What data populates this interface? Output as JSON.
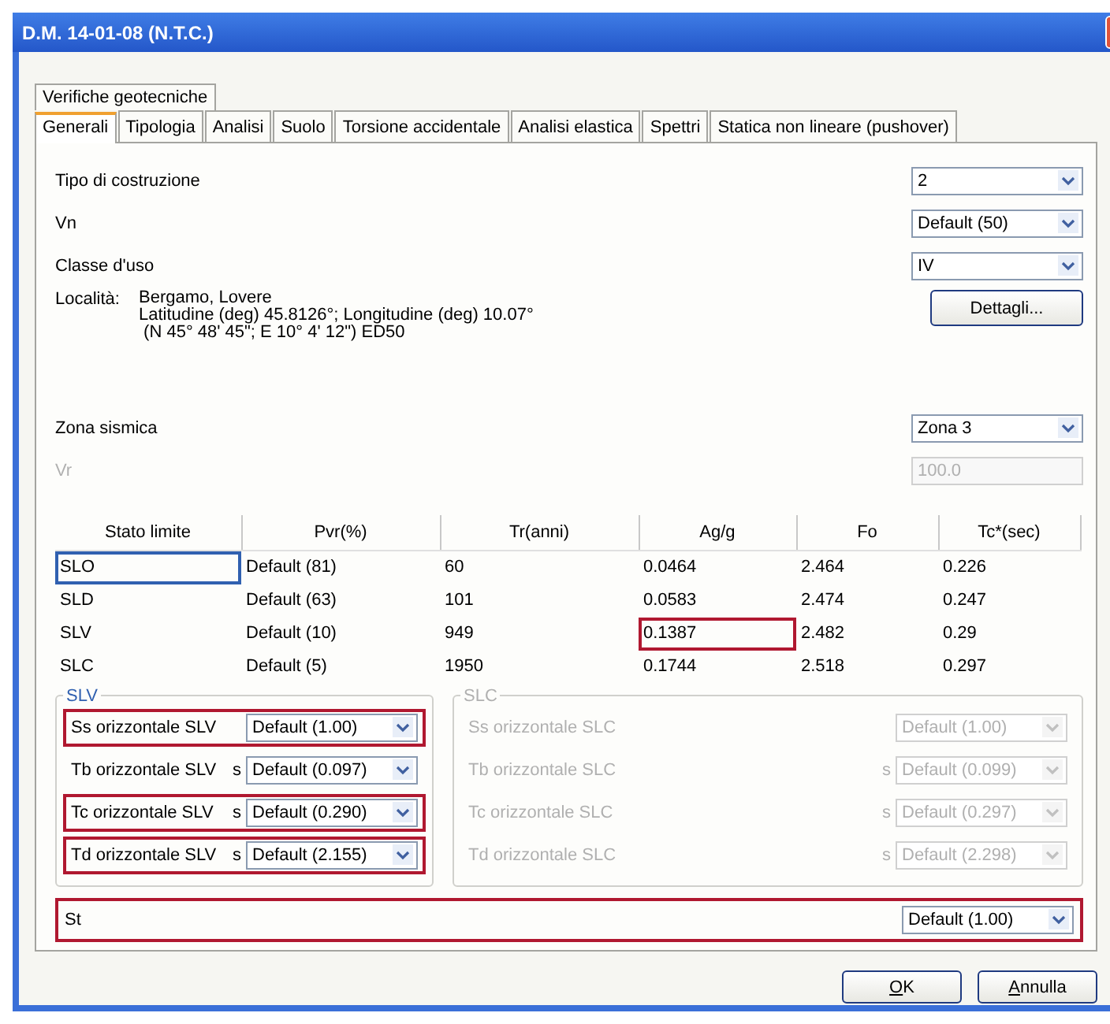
{
  "window": {
    "title": "D.M. 14-01-08 (N.T.C.)"
  },
  "tabs_top": [
    {
      "label": "Verifiche geotecniche",
      "selected": false
    }
  ],
  "tabs": [
    {
      "label": "Generali",
      "selected": true
    },
    {
      "label": "Tipologia",
      "selected": false
    },
    {
      "label": "Analisi",
      "selected": false
    },
    {
      "label": "Suolo",
      "selected": false
    },
    {
      "label": "Torsione accidentale",
      "selected": false
    },
    {
      "label": "Analisi elastica",
      "selected": false
    },
    {
      "label": "Spettri",
      "selected": false
    },
    {
      "label": "Statica non lineare (pushover)",
      "selected": false
    }
  ],
  "general_fields": [
    {
      "label": "Tipo di costruzione",
      "value": "2",
      "kind": "dropdown",
      "disabled": false
    },
    {
      "label": "Vn",
      "value": "Default (50)",
      "kind": "dropdown",
      "disabled": false
    },
    {
      "label": "Classe d'uso",
      "value": "IV",
      "kind": "dropdown",
      "disabled": false
    }
  ],
  "location": {
    "label": "Località:",
    "lines": [
      "Bergamo, Lovere",
      "Latitudine (deg) 45.8126°; Longitudine (deg) 10.07°",
      " (N 45° 48' 45\"; E 10° 4' 12\") ED50"
    ],
    "button": "Dettagli..."
  },
  "zone_fields": [
    {
      "label": "Zona sismica",
      "value": "Zona 3",
      "kind": "dropdown",
      "disabled": false
    },
    {
      "label": "Vr",
      "value": "100.0",
      "kind": "textbox",
      "disabled": true
    }
  ],
  "table": {
    "columns": [
      "Stato limite",
      "Pvr(%)",
      "Tr(anni)",
      "Ag/g",
      "Fo",
      "Tc*(sec)"
    ],
    "rows": [
      {
        "cells": [
          "SLO",
          "Default (81)",
          "60",
          "0.0464",
          "2.464",
          "0.226"
        ],
        "focused": true,
        "highlighted": false
      },
      {
        "cells": [
          "SLD",
          "Default (63)",
          "101",
          "0.0583",
          "2.474",
          "0.247"
        ],
        "focused": false,
        "highlighted": false
      },
      {
        "cells": [
          "SLV",
          "Default (10)",
          "949",
          "0.1387",
          "2.482",
          "0.29"
        ],
        "focused": false,
        "highlighted": true
      },
      {
        "cells": [
          "SLC",
          "Default (5)",
          "1950",
          "0.1744",
          "2.518",
          "0.297"
        ],
        "focused": false,
        "highlighted": false
      }
    ]
  },
  "groups": [
    {
      "title": "SLV",
      "disabled": false,
      "rows": [
        {
          "label": "Ss orizzontale SLV",
          "value": "Default (1.00)",
          "highlighted": true
        },
        {
          "label": "Tb orizzontale SLV",
          "unit": "s",
          "value": "Default (0.097)",
          "highlighted": false
        },
        {
          "label": "Tc orizzontale SLV",
          "unit": "s",
          "value": "Default (0.290)",
          "highlighted": true
        },
        {
          "label": "Td orizzontale SLV",
          "unit": "s",
          "value": "Default (2.155)",
          "highlighted": true
        }
      ]
    },
    {
      "title": "SLC",
      "disabled": true,
      "rows": [
        {
          "label": "Ss orizzontale SLC",
          "value": "Default (1.00)",
          "highlighted": false
        },
        {
          "label": "Tb orizzontale SLC",
          "unit": "s",
          "value": "Default (0.099)",
          "highlighted": false
        },
        {
          "label": "Tc orizzontale SLC",
          "unit": "s",
          "value": "Default (0.297)",
          "highlighted": false
        },
        {
          "label": "Td orizzontale SLC",
          "unit": "s",
          "value": "Default (2.298)",
          "highlighted": false
        }
      ]
    }
  ],
  "st": {
    "label": "St",
    "value": "Default (1.00)",
    "highlighted": true
  },
  "buttons": [
    "OK",
    "Annulla"
  ]
}
